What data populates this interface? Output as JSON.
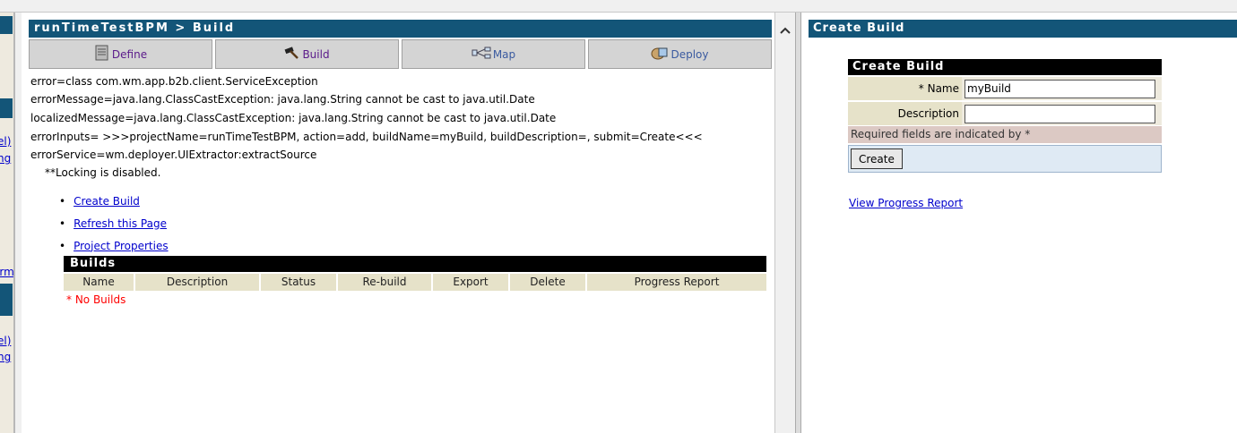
{
  "left_frame": {
    "fragments": [
      "el)",
      "ng",
      "orm",
      "el)",
      "ng"
    ]
  },
  "main": {
    "title": "runTimeTestBPM > Build",
    "tabs": [
      {
        "label": "Define",
        "icon": "document-icon"
      },
      {
        "label": "Build",
        "icon": "hammer-icon"
      },
      {
        "label": "Map",
        "icon": "map-icon"
      },
      {
        "label": "Deploy",
        "icon": "package-icon"
      }
    ],
    "errors": [
      "error=class com.wm.app.b2b.client.ServiceException",
      "errorMessage=java.lang.ClassCastException: java.lang.String cannot be cast to java.util.Date",
      "localizedMessage=java.lang.ClassCastException: java.lang.String cannot be cast to java.util.Date",
      "errorInputs= >>>projectName=runTimeTestBPM, action=add, buildName=myBuild, buildDescription=, submit=Create<<<",
      "errorService=wm.deployer.UIExtractor:extractSource"
    ],
    "lock_note": "**Locking is disabled.",
    "links": [
      "Create Build",
      "Refresh this Page",
      "Project Properties"
    ],
    "builds": {
      "title": "Builds",
      "columns": [
        "Name",
        "Description",
        "Status",
        "Re-build",
        "Export",
        "Delete",
        "Progress Report"
      ],
      "empty_message": "* No Builds"
    }
  },
  "right": {
    "title": "Create Build",
    "form": {
      "header": "Create Build",
      "name_label": "* Name",
      "name_value": "myBuild",
      "description_label": "Description",
      "description_value": "",
      "required_note": "Required fields are indicated by *",
      "create_button": "Create"
    },
    "progress_link": "View Progress Report"
  },
  "colors": {
    "title_bar": "#135578",
    "header_cell": "#e6e2c9",
    "error_text": "#ff0000",
    "link": "#0000cc"
  }
}
